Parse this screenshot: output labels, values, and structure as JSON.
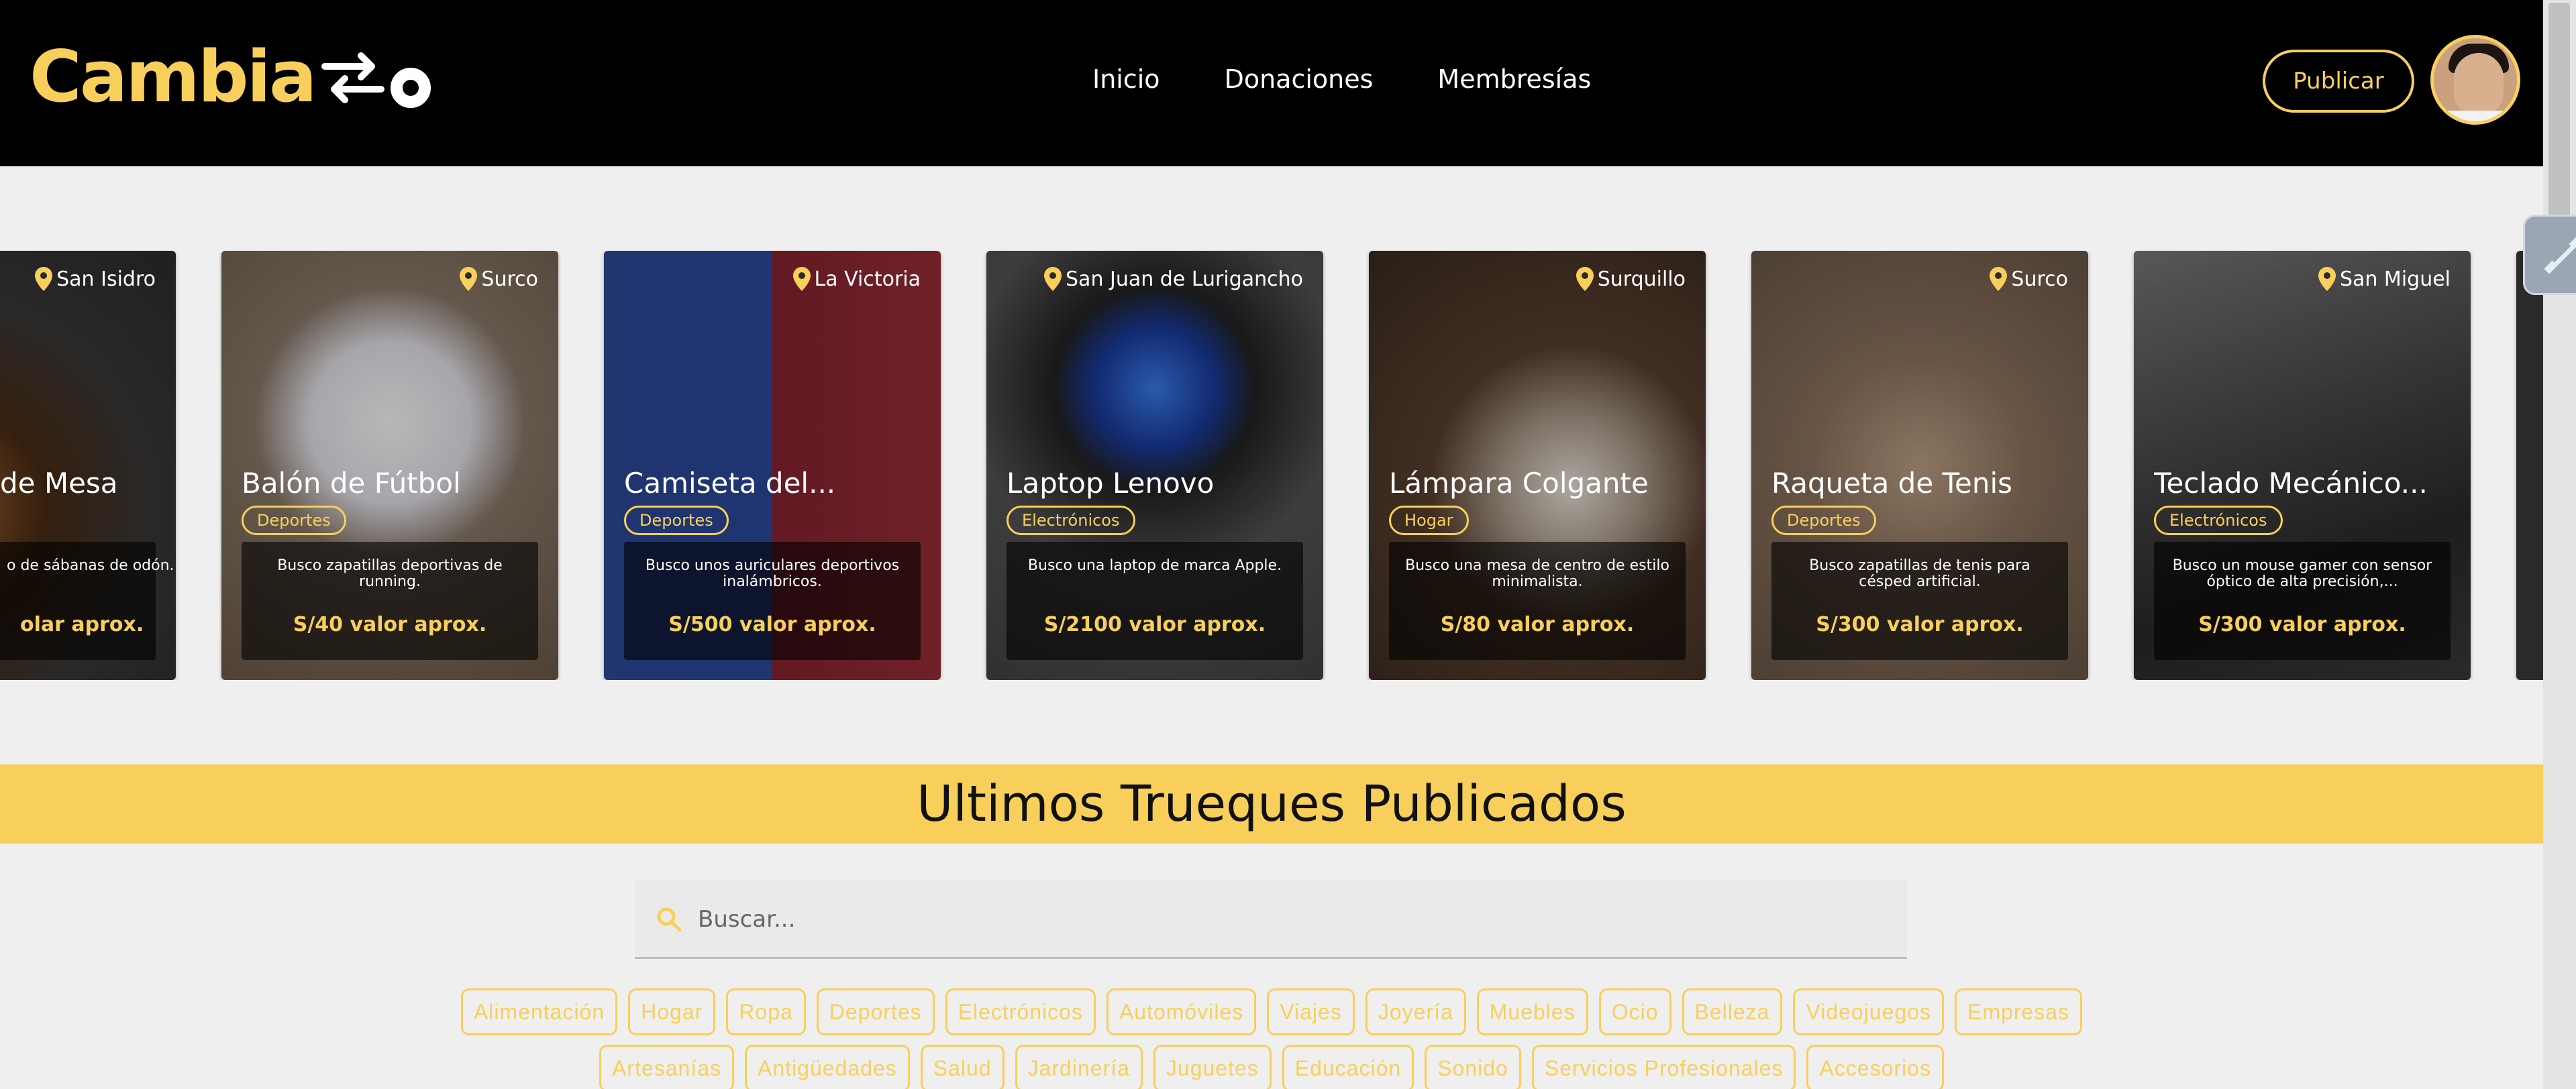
{
  "brand": {
    "logo_text": "Cambia",
    "logo_suffix": "o"
  },
  "nav": {
    "items": [
      "Inicio",
      "Donaciones",
      "Membresías"
    ]
  },
  "header": {
    "publish_label": "Publicar"
  },
  "cards": [
    {
      "location": "San Isidro",
      "title": "de Mesa",
      "category": "",
      "description": "o de sábanas de\nodón.",
      "price": "olar aprox."
    },
    {
      "location": "Surco",
      "title": "Balón de Fútbol",
      "category": "Deportes",
      "description": "Busco zapatillas deportivas de running.",
      "price": "S/40 valor aprox."
    },
    {
      "location": "La Victoria",
      "title": "Camiseta del...",
      "category": "Deportes",
      "description": "Busco unos auriculares deportivos inalámbricos.",
      "price": "S/500 valor aprox."
    },
    {
      "location": "San Juan de Lurigancho",
      "title": "Laptop Lenovo",
      "category": "Electrónicos",
      "description": "Busco una laptop de marca Apple.",
      "price": "S/2100 valor aprox."
    },
    {
      "location": "Surquillo",
      "title": "Lámpara Colgante",
      "category": "Hogar",
      "description": "Busco una mesa de centro de estilo minimalista.",
      "price": "S/80 valor aprox."
    },
    {
      "location": "Surco",
      "title": "Raqueta de Tenis",
      "category": "Deportes",
      "description": "Busco zapatillas de tenis para césped artificial.",
      "price": "S/300 valor aprox."
    },
    {
      "location": "San Miguel",
      "title": "Teclado Mecánico...",
      "category": "Electrónicos",
      "description": "Busco un mouse gamer con sensor óptico de alta precisión,...",
      "price": "S/300 valor aprox."
    }
  ],
  "section": {
    "title": "Ultimos Trueques Publicados"
  },
  "search": {
    "placeholder": "Buscar..."
  },
  "categories_row1": [
    "Alimentación",
    "Hogar",
    "Ropa",
    "Deportes",
    "Electrónicos",
    "Automóviles",
    "Viajes",
    "Joyería",
    "Muebles",
    "Ocio",
    "Belleza",
    "Videojuegos",
    "Empresas"
  ],
  "categories_row2": [
    "Artesanías",
    "Antigüedades",
    "Salud",
    "Jardinería",
    "Juguetes",
    "Educación",
    "Sonido",
    "Servicios Profesionales",
    "Accesorios"
  ],
  "colors": {
    "accent": "#f8cf5a",
    "header_bg": "#000000",
    "page_bg": "#efefef"
  }
}
